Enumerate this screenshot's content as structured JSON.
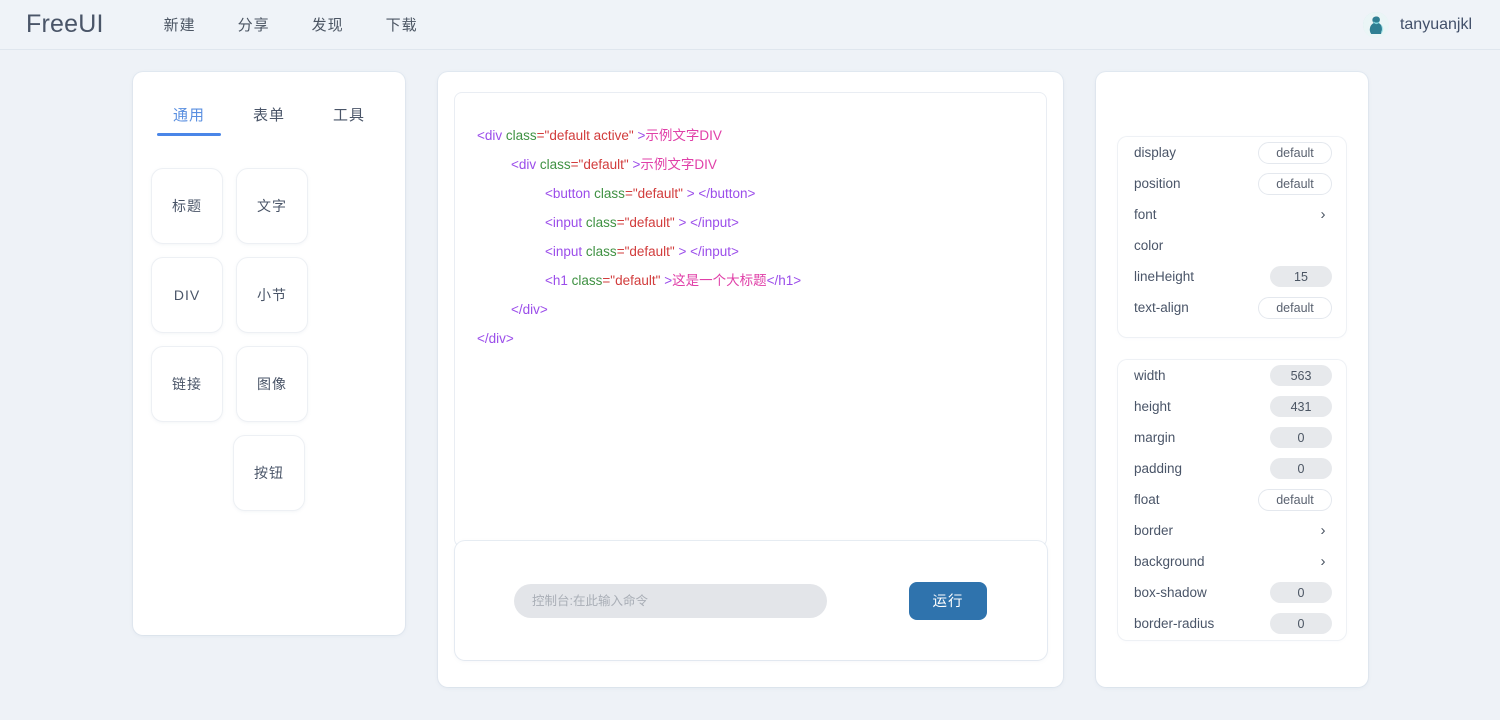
{
  "header": {
    "logo": "FreeUI",
    "nav": [
      {
        "label": "新建"
      },
      {
        "label": "分享"
      },
      {
        "label": "发现"
      },
      {
        "label": "下载"
      }
    ],
    "user": {
      "name": "tanyuanjkl",
      "avatar_icon": "avatar-person-icon"
    }
  },
  "left_panel": {
    "tabs": [
      {
        "label": "通用",
        "active": true
      },
      {
        "label": "表单",
        "active": false
      },
      {
        "label": "工具",
        "active": false
      }
    ],
    "components": [
      {
        "label": "标题"
      },
      {
        "label": "文字"
      },
      {
        "label": "DIV"
      },
      {
        "label": "小节"
      },
      {
        "label": "链接"
      },
      {
        "label": "图像"
      },
      {
        "label": "按钮"
      }
    ]
  },
  "editor": {
    "lines": [
      {
        "indent": 0,
        "parts": [
          {
            "t": "tag",
            "s": "<div "
          },
          {
            "t": "attr",
            "s": "class"
          },
          {
            "t": "val",
            "s": "=\"default active\" "
          },
          {
            "t": "tag",
            "s": ">"
          },
          {
            "t": "txt",
            "s": "示例文字DIV"
          }
        ]
      },
      {
        "indent": 1,
        "parts": [
          {
            "t": "tag",
            "s": "<div "
          },
          {
            "t": "attr",
            "s": "class"
          },
          {
            "t": "val",
            "s": "=\"default\" "
          },
          {
            "t": "tag",
            "s": ">"
          },
          {
            "t": "txt",
            "s": "示例文字DIV"
          }
        ]
      },
      {
        "indent": 2,
        "parts": [
          {
            "t": "tag",
            "s": "<button "
          },
          {
            "t": "attr",
            "s": "class"
          },
          {
            "t": "val",
            "s": "=\"default\" "
          },
          {
            "t": "tag",
            "s": "> </button>"
          }
        ]
      },
      {
        "indent": 2,
        "parts": [
          {
            "t": "tag",
            "s": "<input "
          },
          {
            "t": "attr",
            "s": "class"
          },
          {
            "t": "val",
            "s": "=\"default\" "
          },
          {
            "t": "tag",
            "s": "> </input>"
          }
        ]
      },
      {
        "indent": 2,
        "parts": [
          {
            "t": "tag",
            "s": "<input "
          },
          {
            "t": "attr",
            "s": "class"
          },
          {
            "t": "val",
            "s": "=\"default\" "
          },
          {
            "t": "tag",
            "s": "> </input>"
          }
        ]
      },
      {
        "indent": 2,
        "parts": [
          {
            "t": "tag",
            "s": "<h1 "
          },
          {
            "t": "attr",
            "s": "class"
          },
          {
            "t": "val",
            "s": "=\"default\" "
          },
          {
            "t": "tag",
            "s": ">"
          },
          {
            "t": "txt",
            "s": "这是一个大标题"
          },
          {
            "t": "tag",
            "s": "</h1>"
          }
        ]
      },
      {
        "indent": 1,
        "parts": [
          {
            "t": "tag",
            "s": "</div>"
          }
        ]
      },
      {
        "indent": 0,
        "parts": [
          {
            "t": "tag",
            "s": "</div>"
          }
        ]
      }
    ],
    "syntax_colors": {
      "tag": "#9b4dea",
      "attribute": "#3f9142",
      "value": "#d23c3c",
      "text": "#e040a8"
    }
  },
  "console": {
    "placeholder": "控制台:在此输入命令",
    "value": "",
    "run_label": "运行",
    "run_color": "#2f73ad"
  },
  "properties": {
    "group1": [
      {
        "label": "display",
        "control": "default-pill",
        "value": "default"
      },
      {
        "label": "position",
        "control": "default-pill",
        "value": "default"
      },
      {
        "label": "font",
        "control": "chevron",
        "value": ""
      },
      {
        "label": "color",
        "control": "none",
        "value": ""
      },
      {
        "label": "lineHeight",
        "control": "value-pill",
        "value": "15"
      },
      {
        "label": "text-align",
        "control": "default-pill",
        "value": "default"
      }
    ],
    "group2": [
      {
        "label": "width",
        "control": "value-pill",
        "value": "563"
      },
      {
        "label": "height",
        "control": "value-pill",
        "value": "431"
      },
      {
        "label": "margin",
        "control": "value-pill",
        "value": "0"
      },
      {
        "label": "padding",
        "control": "value-pill",
        "value": "0"
      },
      {
        "label": "float",
        "control": "default-pill",
        "value": "default"
      },
      {
        "label": "border",
        "control": "chevron",
        "value": ""
      },
      {
        "label": "background",
        "control": "chevron",
        "value": ""
      },
      {
        "label": "box-shadow",
        "control": "value-pill",
        "value": "0"
      },
      {
        "label": "border-radius",
        "control": "value-pill",
        "value": "0"
      }
    ]
  }
}
